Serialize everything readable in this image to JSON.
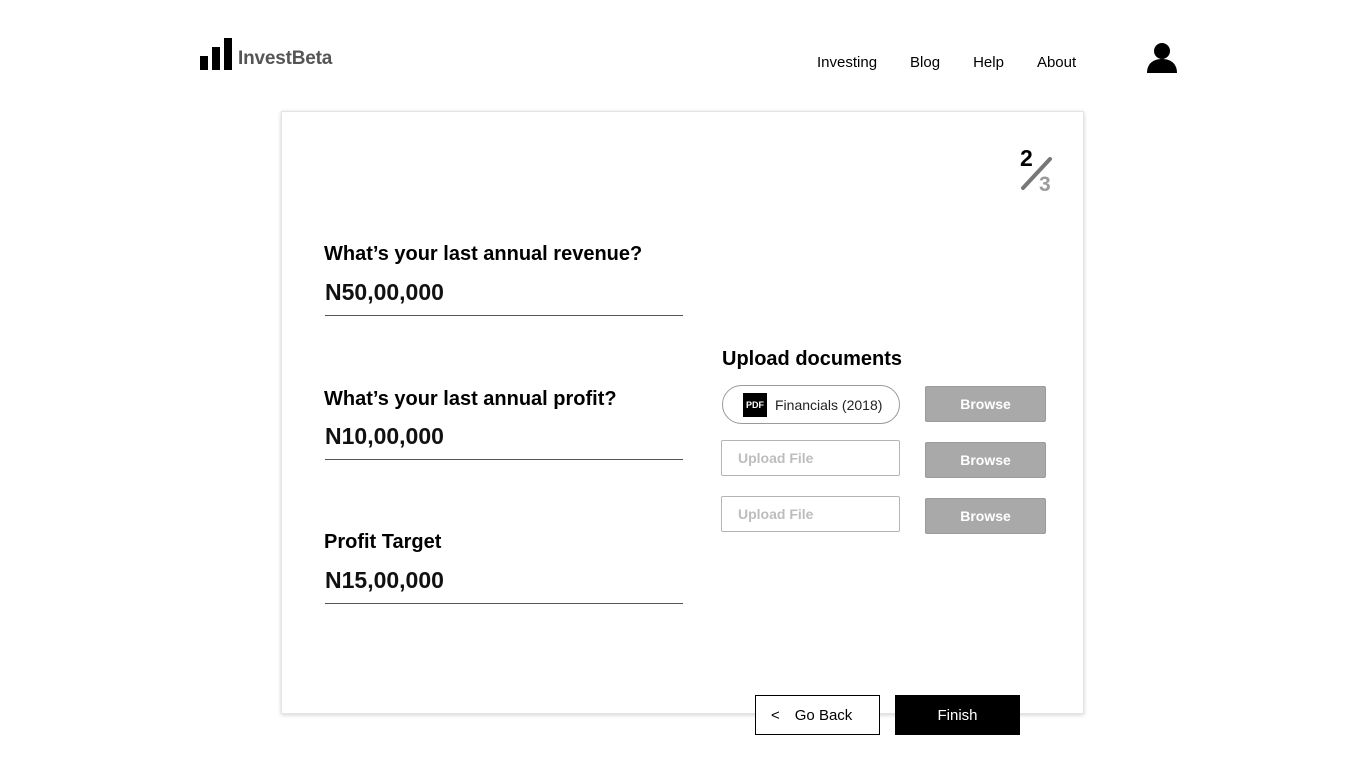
{
  "header": {
    "logo_text": "InvestBeta",
    "nav": [
      "Investing",
      "Blog",
      "Help",
      "About"
    ]
  },
  "step": {
    "current": "2",
    "total": "3"
  },
  "form": {
    "fields": [
      {
        "label": "What’s your last annual revenue?",
        "value": "N50,00,000"
      },
      {
        "label": "What’s your last annual profit?",
        "value": "N10,00,000"
      },
      {
        "label": "Profit Target",
        "value": "N15,00,000"
      }
    ]
  },
  "upload": {
    "title": "Upload documents",
    "file": {
      "badge": "PDF",
      "name": "Financials (2018)"
    },
    "placeholder": "Upload File",
    "browse_label": "Browse"
  },
  "actions": {
    "back_chevron": "<",
    "back_label": "Go Back",
    "finish_label": "Finish"
  },
  "colors": {
    "primary": "#000000",
    "browse_bg": "#a9a9a9",
    "step_total": "#9b9b9b",
    "logo_text": "#555555"
  },
  "icons": {
    "logo": "bar-chart-icon",
    "user": "user-icon",
    "file": "pdf-icon"
  }
}
